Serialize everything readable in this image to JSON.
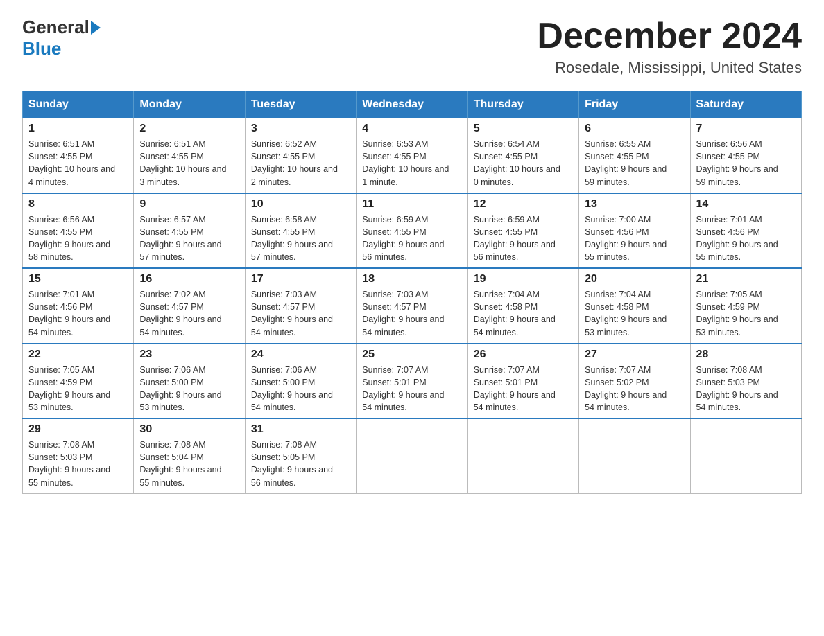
{
  "header": {
    "logo_general": "General",
    "logo_blue": "Blue",
    "title": "December 2024",
    "subtitle": "Rosedale, Mississippi, United States"
  },
  "days_of_week": [
    "Sunday",
    "Monday",
    "Tuesday",
    "Wednesday",
    "Thursday",
    "Friday",
    "Saturday"
  ],
  "weeks": [
    [
      {
        "day": "1",
        "sunrise": "6:51 AM",
        "sunset": "4:55 PM",
        "daylight": "10 hours and 4 minutes."
      },
      {
        "day": "2",
        "sunrise": "6:51 AM",
        "sunset": "4:55 PM",
        "daylight": "10 hours and 3 minutes."
      },
      {
        "day": "3",
        "sunrise": "6:52 AM",
        "sunset": "4:55 PM",
        "daylight": "10 hours and 2 minutes."
      },
      {
        "day": "4",
        "sunrise": "6:53 AM",
        "sunset": "4:55 PM",
        "daylight": "10 hours and 1 minute."
      },
      {
        "day": "5",
        "sunrise": "6:54 AM",
        "sunset": "4:55 PM",
        "daylight": "10 hours and 0 minutes."
      },
      {
        "day": "6",
        "sunrise": "6:55 AM",
        "sunset": "4:55 PM",
        "daylight": "9 hours and 59 minutes."
      },
      {
        "day": "7",
        "sunrise": "6:56 AM",
        "sunset": "4:55 PM",
        "daylight": "9 hours and 59 minutes."
      }
    ],
    [
      {
        "day": "8",
        "sunrise": "6:56 AM",
        "sunset": "4:55 PM",
        "daylight": "9 hours and 58 minutes."
      },
      {
        "day": "9",
        "sunrise": "6:57 AM",
        "sunset": "4:55 PM",
        "daylight": "9 hours and 57 minutes."
      },
      {
        "day": "10",
        "sunrise": "6:58 AM",
        "sunset": "4:55 PM",
        "daylight": "9 hours and 57 minutes."
      },
      {
        "day": "11",
        "sunrise": "6:59 AM",
        "sunset": "4:55 PM",
        "daylight": "9 hours and 56 minutes."
      },
      {
        "day": "12",
        "sunrise": "6:59 AM",
        "sunset": "4:55 PM",
        "daylight": "9 hours and 56 minutes."
      },
      {
        "day": "13",
        "sunrise": "7:00 AM",
        "sunset": "4:56 PM",
        "daylight": "9 hours and 55 minutes."
      },
      {
        "day": "14",
        "sunrise": "7:01 AM",
        "sunset": "4:56 PM",
        "daylight": "9 hours and 55 minutes."
      }
    ],
    [
      {
        "day": "15",
        "sunrise": "7:01 AM",
        "sunset": "4:56 PM",
        "daylight": "9 hours and 54 minutes."
      },
      {
        "day": "16",
        "sunrise": "7:02 AM",
        "sunset": "4:57 PM",
        "daylight": "9 hours and 54 minutes."
      },
      {
        "day": "17",
        "sunrise": "7:03 AM",
        "sunset": "4:57 PM",
        "daylight": "9 hours and 54 minutes."
      },
      {
        "day": "18",
        "sunrise": "7:03 AM",
        "sunset": "4:57 PM",
        "daylight": "9 hours and 54 minutes."
      },
      {
        "day": "19",
        "sunrise": "7:04 AM",
        "sunset": "4:58 PM",
        "daylight": "9 hours and 54 minutes."
      },
      {
        "day": "20",
        "sunrise": "7:04 AM",
        "sunset": "4:58 PM",
        "daylight": "9 hours and 53 minutes."
      },
      {
        "day": "21",
        "sunrise": "7:05 AM",
        "sunset": "4:59 PM",
        "daylight": "9 hours and 53 minutes."
      }
    ],
    [
      {
        "day": "22",
        "sunrise": "7:05 AM",
        "sunset": "4:59 PM",
        "daylight": "9 hours and 53 minutes."
      },
      {
        "day": "23",
        "sunrise": "7:06 AM",
        "sunset": "5:00 PM",
        "daylight": "9 hours and 53 minutes."
      },
      {
        "day": "24",
        "sunrise": "7:06 AM",
        "sunset": "5:00 PM",
        "daylight": "9 hours and 54 minutes."
      },
      {
        "day": "25",
        "sunrise": "7:07 AM",
        "sunset": "5:01 PM",
        "daylight": "9 hours and 54 minutes."
      },
      {
        "day": "26",
        "sunrise": "7:07 AM",
        "sunset": "5:01 PM",
        "daylight": "9 hours and 54 minutes."
      },
      {
        "day": "27",
        "sunrise": "7:07 AM",
        "sunset": "5:02 PM",
        "daylight": "9 hours and 54 minutes."
      },
      {
        "day": "28",
        "sunrise": "7:08 AM",
        "sunset": "5:03 PM",
        "daylight": "9 hours and 54 minutes."
      }
    ],
    [
      {
        "day": "29",
        "sunrise": "7:08 AM",
        "sunset": "5:03 PM",
        "daylight": "9 hours and 55 minutes."
      },
      {
        "day": "30",
        "sunrise": "7:08 AM",
        "sunset": "5:04 PM",
        "daylight": "9 hours and 55 minutes."
      },
      {
        "day": "31",
        "sunrise": "7:08 AM",
        "sunset": "5:05 PM",
        "daylight": "9 hours and 56 minutes."
      },
      null,
      null,
      null,
      null
    ]
  ],
  "labels": {
    "sunrise": "Sunrise:",
    "sunset": "Sunset:",
    "daylight": "Daylight:"
  }
}
